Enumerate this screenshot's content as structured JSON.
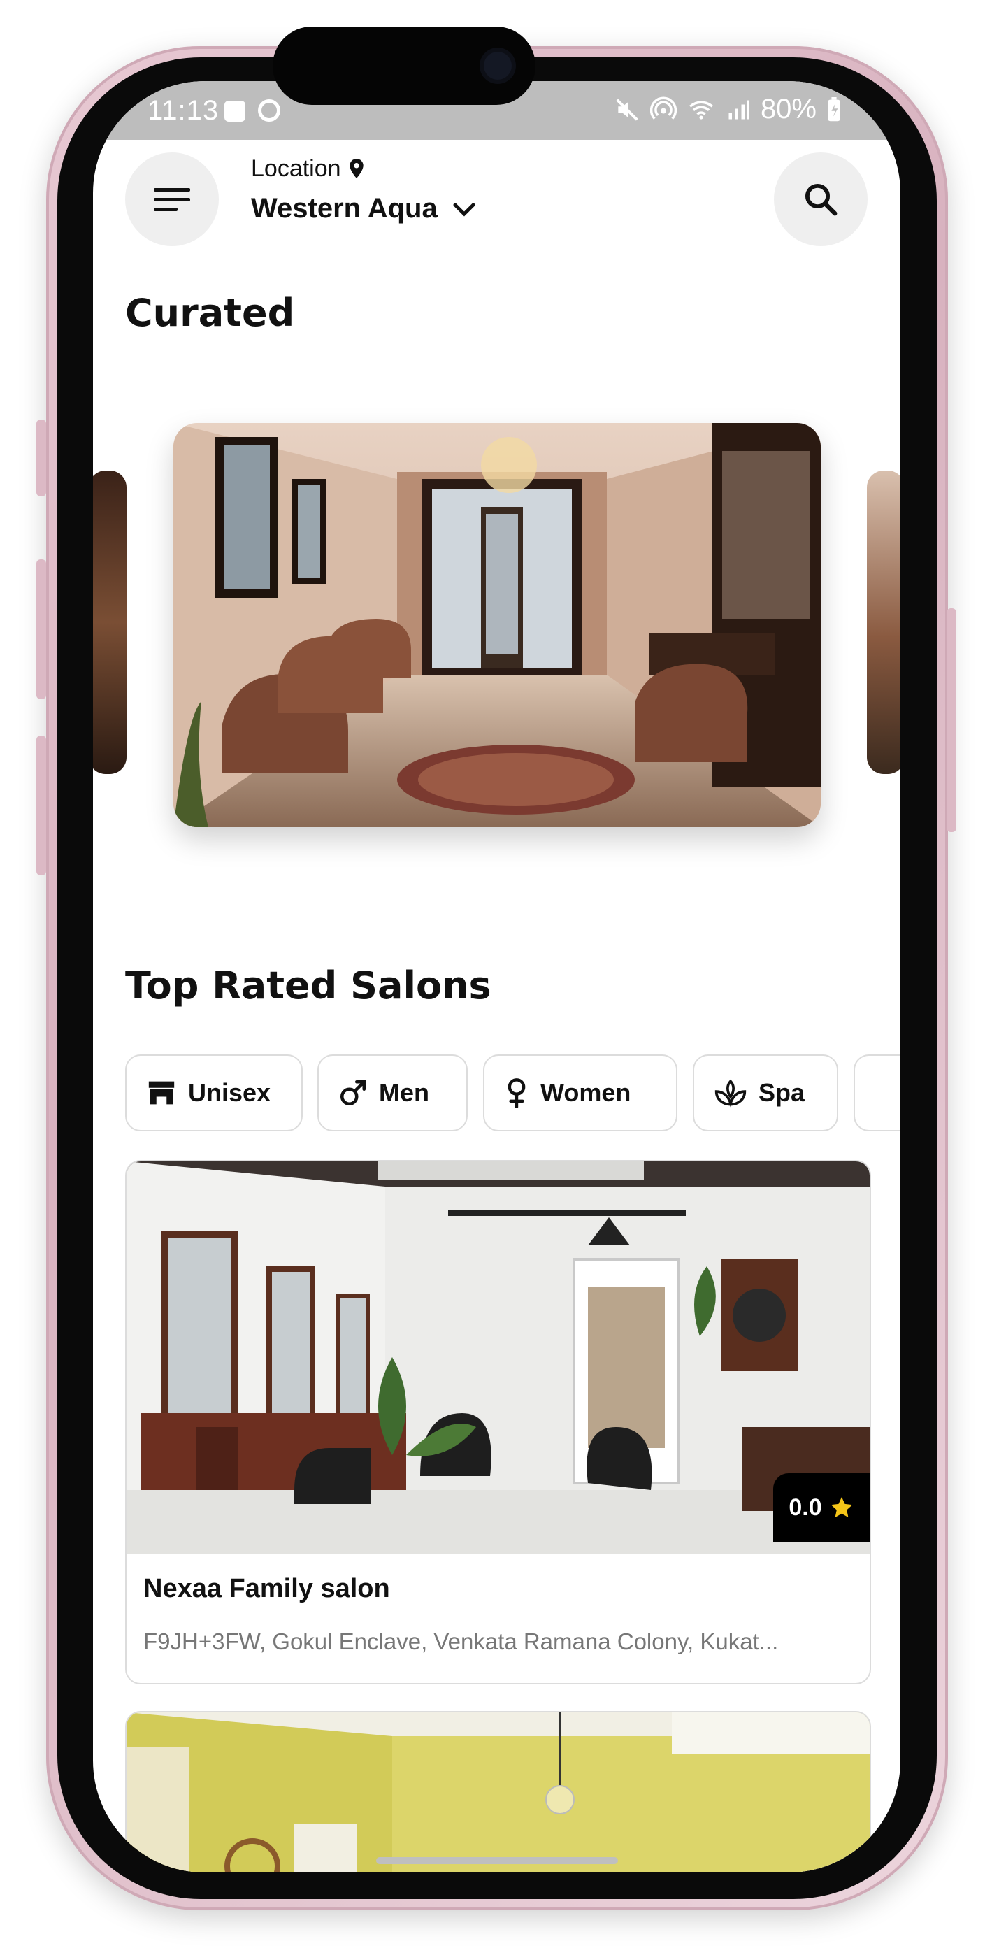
{
  "status_bar": {
    "time": "11:13",
    "battery": "80%"
  },
  "header": {
    "location_label": "Location",
    "location_value": "Western Aqua"
  },
  "curated": {
    "title": "Curated"
  },
  "top_rated": {
    "title": "Top Rated Salons",
    "categories": [
      {
        "label": "Unisex",
        "icon": "storefront-icon"
      },
      {
        "label": "Men",
        "icon": "male-icon"
      },
      {
        "label": "Women",
        "icon": "female-icon"
      },
      {
        "label": "Spa",
        "icon": "spa-icon"
      }
    ],
    "salons": [
      {
        "name": "Nexaa Family salon",
        "address": "F9JH+3FW, Gokul Enclave, Venkata Ramana Colony, Kukat...",
        "rating": "0.0"
      }
    ]
  },
  "colors": {
    "accent": "#111111",
    "chip_border": "#dcdcdc",
    "star": "#f5c518"
  }
}
